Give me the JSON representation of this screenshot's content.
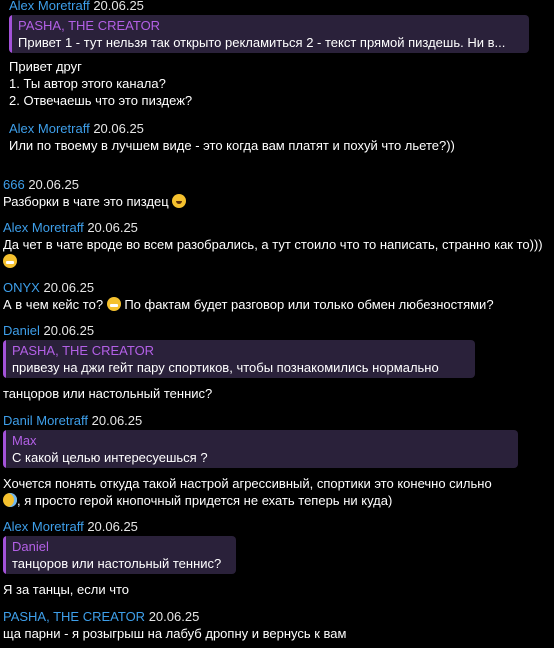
{
  "messages": [
    {
      "author": "Alex Moretraff",
      "date": "20.06.25",
      "quote": {
        "author": "PASHA, THE CREATOR",
        "text": "Привет   1 - тут нельзя так открыто рекламиться 2 - текст прямой пиздешь. Ни в..."
      },
      "text": "Привет друг\n1. Ты автор этого канала?\n2. Отвечаешь что это пиздеж?"
    },
    {
      "author": "Alex Moretraff",
      "date": "20.06.25",
      "text": "Или по твоему в лучшем виде - это когда вам платят и похуй что льете?))"
    },
    {
      "author": "666",
      "date": "20.06.25",
      "text": "Разборки в чате это пиздец",
      "emoji": "laugh-crying-icon"
    },
    {
      "author": "Alex Moretraff",
      "date": "20.06.25",
      "text": "Да чет в чате вроде во всем разобрались, а тут стоило что то написать, странно как то)))",
      "emoji": "grinning-icon"
    },
    {
      "author": "ONYX",
      "date": "20.06.25",
      "text_a": "А в чем кейс то?",
      "text_b": "По фактам будет разговор или только обмен любезностями?",
      "emoji": "grimacing-icon"
    },
    {
      "author": "Daniel",
      "date": "20.06.25",
      "quote": {
        "author": "PASHA, THE CREATOR",
        "text": "привезу на джи гейт пару спортиков, чтобы познакомились нормально"
      },
      "text": "танцоров или настольный теннис?"
    },
    {
      "author": "Danil Moretraff",
      "date": "20.06.25",
      "quote": {
        "author": "Max",
        "text": "С какой целью интересуешься ?"
      },
      "text": "Хочется понять откуда такой настрой агрессивный, спортики это конечно сильно",
      "text_b": ", я просто герой кнопочный придется не ехать теперь ни куда)",
      "emoji": "tears-of-joy-icon"
    },
    {
      "author": "Alex Moretraff",
      "date": "20.06.25",
      "quote": {
        "author": "Daniel",
        "text": "танцоров или настольный теннис?"
      },
      "text": "Я за танцы, если что"
    },
    {
      "author": "PASHA, THE CREATOR",
      "date": "20.06.25",
      "text": "ща парни - я розыгрыш на лабуб дропну и вернусь к вам"
    }
  ]
}
